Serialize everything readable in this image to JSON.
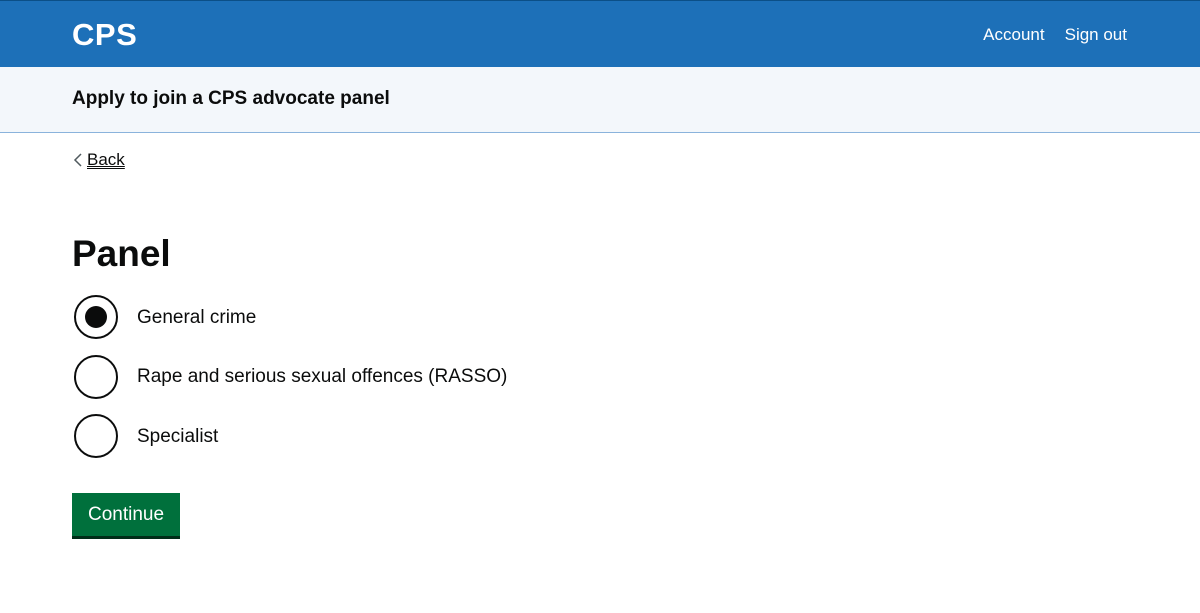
{
  "header": {
    "logo": "CPS",
    "nav": {
      "account": "Account",
      "sign_out": "Sign out"
    },
    "background_color": "#1d70b8"
  },
  "service": {
    "name": "Apply to join a CPS advocate panel"
  },
  "back_link": {
    "label": "Back"
  },
  "form": {
    "title": "Panel",
    "options": [
      {
        "label": "General crime",
        "selected": true
      },
      {
        "label": "Rape and serious sexual offences (RASSO)",
        "selected": false
      },
      {
        "label": "Specialist",
        "selected": false
      }
    ],
    "continue_label": "Continue",
    "button_color": "#00703c"
  }
}
